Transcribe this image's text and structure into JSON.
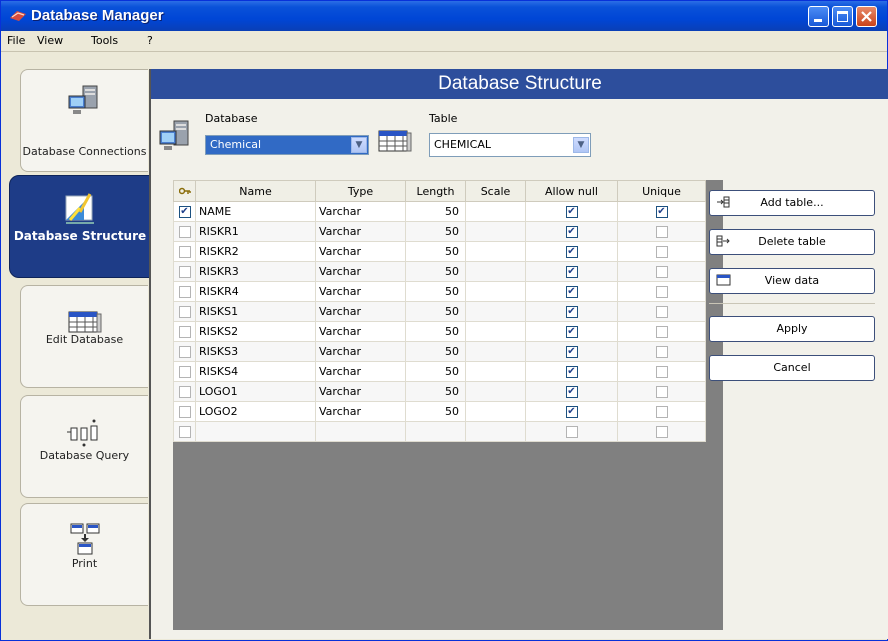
{
  "window": {
    "title": "Database Manager"
  },
  "menu": [
    "File",
    "View",
    "Tools",
    "?"
  ],
  "nav": [
    {
      "label": "Database Connections",
      "icon": "database-connections-icon"
    },
    {
      "label": "Database Structure",
      "icon": "database-structure-icon"
    },
    {
      "label": "Edit Database",
      "icon": "edit-database-icon"
    },
    {
      "label": "Database Query",
      "icon": "database-query-icon"
    },
    {
      "label": "Print",
      "icon": "print-icon"
    }
  ],
  "header": {
    "title": "Database Structure"
  },
  "database": {
    "label": "Database",
    "value": "Chemical"
  },
  "table_sel": {
    "label": "Table",
    "value": "CHEMICAL"
  },
  "grid": {
    "columns": [
      "",
      "Name",
      "Type",
      "Length",
      "Scale",
      "Allow null",
      "Unique"
    ],
    "rows": [
      {
        "key": true,
        "name": "NAME",
        "type": "Varchar",
        "length": "50",
        "scale": "",
        "allow_null": true,
        "unique": true
      },
      {
        "key": false,
        "name": "RISKR1",
        "type": "Varchar",
        "length": "50",
        "scale": "",
        "allow_null": true,
        "unique": false
      },
      {
        "key": false,
        "name": "RISKR2",
        "type": "Varchar",
        "length": "50",
        "scale": "",
        "allow_null": true,
        "unique": false
      },
      {
        "key": false,
        "name": "RISKR3",
        "type": "Varchar",
        "length": "50",
        "scale": "",
        "allow_null": true,
        "unique": false
      },
      {
        "key": false,
        "name": "RISKR4",
        "type": "Varchar",
        "length": "50",
        "scale": "",
        "allow_null": true,
        "unique": false
      },
      {
        "key": false,
        "name": "RISKS1",
        "type": "Varchar",
        "length": "50",
        "scale": "",
        "allow_null": true,
        "unique": false
      },
      {
        "key": false,
        "name": "RISKS2",
        "type": "Varchar",
        "length": "50",
        "scale": "",
        "allow_null": true,
        "unique": false
      },
      {
        "key": false,
        "name": "RISKS3",
        "type": "Varchar",
        "length": "50",
        "scale": "",
        "allow_null": true,
        "unique": false
      },
      {
        "key": false,
        "name": "RISKS4",
        "type": "Varchar",
        "length": "50",
        "scale": "",
        "allow_null": true,
        "unique": false
      },
      {
        "key": false,
        "name": "LOGO1",
        "type": "Varchar",
        "length": "50",
        "scale": "",
        "allow_null": true,
        "unique": false
      },
      {
        "key": false,
        "name": "LOGO2",
        "type": "Varchar",
        "length": "50",
        "scale": "",
        "allow_null": true,
        "unique": false
      },
      {
        "key": false,
        "name": "",
        "type": "",
        "length": "",
        "scale": "",
        "allow_null": false,
        "unique": false
      }
    ]
  },
  "actions": {
    "add_table": "Add table...",
    "delete_table": "Delete table",
    "view_data": "View data",
    "apply": "Apply",
    "cancel": "Cancel"
  },
  "colors": {
    "title_blue": "#0046d6",
    "header_blue": "#2d4e9c",
    "nav_active": "#1e3c87",
    "grid_bg": "#808080"
  }
}
